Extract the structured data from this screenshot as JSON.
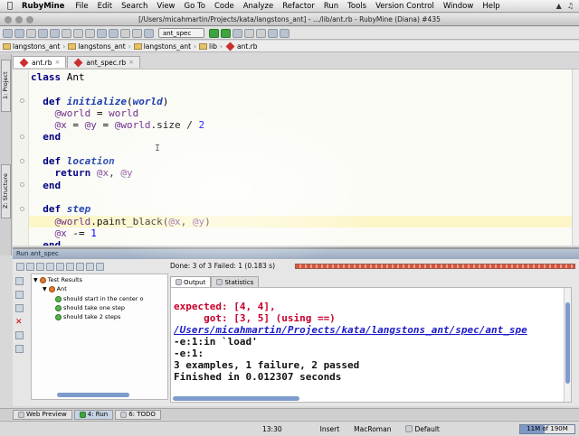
{
  "menubar": {
    "apple": "",
    "app_name": "RubyMine",
    "items": [
      "File",
      "Edit",
      "Search",
      "View",
      "Go To",
      "Code",
      "Analyze",
      "Refactor",
      "Run",
      "Tools",
      "Version Control",
      "Window",
      "Help"
    ]
  },
  "window": {
    "title": "[/Users/micahmartin/Projects/kata/langstons_ant] - .../lib/ant.rb - RubyMine (Diana) #435"
  },
  "toolbar": {
    "run_config": "ant_spec"
  },
  "navbar": {
    "crumbs": [
      "langstons_ant",
      "langstons_ant",
      "langstons_ant",
      "lib",
      "ant.rb"
    ]
  },
  "editor_tabs": [
    {
      "label": "ant.rb",
      "active": true
    },
    {
      "label": "ant_spec.rb",
      "active": false
    }
  ],
  "side_tabs": {
    "project": "1: Project",
    "structure": "Z: Structure"
  },
  "editor": {
    "lines": [
      [
        {
          "t": "class ",
          "c": "kw"
        },
        {
          "t": "Ant",
          "c": "tx"
        }
      ],
      [],
      [
        {
          "t": "  def ",
          "c": "kw"
        },
        {
          "t": "initialize",
          "c": "mn"
        },
        {
          "t": "(",
          "c": "tx"
        },
        {
          "t": "world",
          "c": "mn"
        },
        {
          "t": ")",
          "c": "tx"
        }
      ],
      [
        {
          "t": "    @world",
          "c": "iv"
        },
        {
          "t": " = ",
          "c": "tx"
        },
        {
          "t": "world",
          "c": "iv"
        }
      ],
      [
        {
          "t": "    @x",
          "c": "iv"
        },
        {
          "t": " = ",
          "c": "tx"
        },
        {
          "t": "@y",
          "c": "iv"
        },
        {
          "t": " = ",
          "c": "tx"
        },
        {
          "t": "@world",
          "c": "iv"
        },
        {
          "t": ".size / ",
          "c": "tx"
        },
        {
          "t": "2",
          "c": "nm"
        }
      ],
      [
        {
          "t": "  end",
          "c": "kw"
        }
      ],
      [],
      [
        {
          "t": "  def ",
          "c": "kw"
        },
        {
          "t": "location",
          "c": "mn"
        }
      ],
      [
        {
          "t": "    return ",
          "c": "kw"
        },
        {
          "t": "@x",
          "c": "iv"
        },
        {
          "t": ", ",
          "c": "tx"
        },
        {
          "t": "@y",
          "c": "iv"
        }
      ],
      [
        {
          "t": "  end",
          "c": "kw"
        }
      ],
      [],
      [
        {
          "t": "  def ",
          "c": "kw"
        },
        {
          "t": "step",
          "c": "mn"
        }
      ],
      [
        {
          "t": "    @world",
          "c": "iv"
        },
        {
          "t": ".paint_black(",
          "c": "tx"
        },
        {
          "t": "@x",
          "c": "iv"
        },
        {
          "t": ", ",
          "c": "tx"
        },
        {
          "t": "@y",
          "c": "iv"
        },
        {
          "t": ")",
          "c": "tx"
        }
      ],
      [
        {
          "t": "    @x",
          "c": "iv"
        },
        {
          "t": " -= ",
          "c": "tx"
        },
        {
          "t": "1",
          "c": "nm"
        }
      ],
      [
        {
          "t": "  end",
          "c": "kw"
        }
      ]
    ],
    "highlighted_line": 12
  },
  "run": {
    "panel_title": "Run  ant_spec",
    "status": "Done: 3 of 3   Failed: 1  (0.183 s)",
    "progress_fraction": 1.0,
    "tree": {
      "root": "Test Results",
      "suite": "Ant",
      "tests": [
        {
          "label": "should start in the center o",
          "passed": true
        },
        {
          "label": "should take one step",
          "passed": true
        },
        {
          "label": "should take 2 steps",
          "passed": true
        }
      ]
    },
    "output_tabs": [
      "Output",
      "Statistics"
    ],
    "console": [
      {
        "t": "expected: [4, 4],",
        "c": "err"
      },
      {
        "t": "     got: [3, 5] (using ==)",
        "c": "err"
      },
      {
        "t": "/Users/micahmartin/Projects/kata/langstons_ant/spec/ant_spe",
        "c": "lnk"
      },
      {
        "t": "-e:1:in `load'",
        "c": "plain"
      },
      {
        "t": "-e:1:",
        "c": "plain"
      },
      {
        "t": "3 examples, 1 failure, 2 passed",
        "c": "plain"
      },
      {
        "t": "Finished in 0.012307 seconds",
        "c": "plain"
      }
    ]
  },
  "bottom_tabs": [
    {
      "label": "Web Preview",
      "active": false
    },
    {
      "label": "4: Run",
      "active": true
    },
    {
      "label": "6: TODO",
      "active": false
    }
  ],
  "statusbar": {
    "position": "13:30",
    "insert_mode": "Insert",
    "encoding": "MacRoman",
    "code_style": "Default",
    "memory": "11M of 190M",
    "memory_fraction": 0.45
  }
}
